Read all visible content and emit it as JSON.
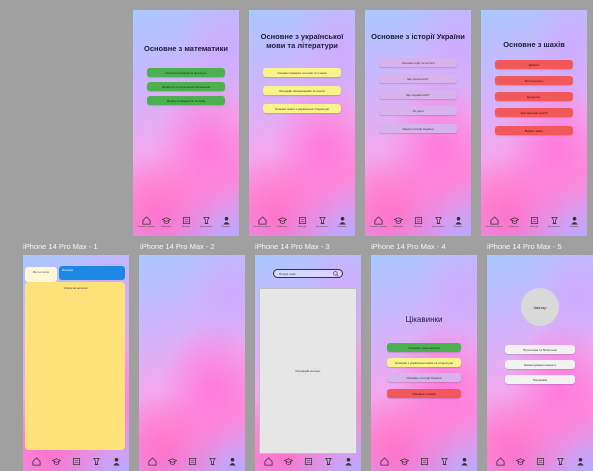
{
  "frames_top": [
    {
      "id": "f1",
      "title": "Основне з математики",
      "buttons": [
        {
          "label": "Основні алгебраїчні формули",
          "color": "green"
        },
        {
          "label": "Формули зі скороченого множення",
          "color": "green"
        },
        {
          "label": "Формули квадратів та кубів",
          "color": "green"
        }
      ]
    },
    {
      "id": "f2",
      "title": "Основне з української мови та літератури",
      "buttons": [
        {
          "label": "Основні правила та поняття з мови",
          "color": "yellow"
        },
        {
          "label": "Біографії письменників та поетів",
          "color": "yellow"
        },
        {
          "label": "Основні твори з української літератури",
          "color": "yellow"
        }
      ]
    },
    {
      "id": "f3",
      "title": "Основне з історії України",
      "buttons": [
        {
          "label": "Основні події та постаті",
          "color": "lilac"
        },
        {
          "label": "Що прочитати?",
          "color": "lilac"
        },
        {
          "label": "Що подивитися?",
          "color": "lilac"
        },
        {
          "label": "Усі дати",
          "color": "lilac"
        },
        {
          "label": "Карти з історії України",
          "color": "lilac"
        }
      ]
    },
    {
      "id": "f4",
      "title": "Основне з шахів",
      "buttons": [
        {
          "label": "Дебюти",
          "color": "red"
        },
        {
          "label": "Міттельшпіль",
          "color": "red"
        },
        {
          "label": "Ендшпіль",
          "color": "red"
        },
        {
          "label": "Чим важливі шахи?",
          "color": "red"
        },
        {
          "label": "Відомі гравці",
          "color": "red"
        }
      ]
    }
  ],
  "frame_labels": [
    "iPhone 14 Pro Max - 1",
    "iPhone 14 Pro Max - 2",
    "iPhone 14 Pro Max - 3",
    "iPhone 14 Pro Max - 4",
    "iPhone 14 Pro Max - 5"
  ],
  "nav_top": [
    {
      "icon": "home-icon",
      "caption": "Головна сторінка"
    },
    {
      "icon": "graduation-cap-icon",
      "caption": "Навчання"
    },
    {
      "icon": "notes-icon",
      "caption": "Нотатки"
    },
    {
      "icon": "trophy-icon",
      "caption": "Досягнення"
    },
    {
      "icon": "user-icon",
      "caption": "Профіль"
    }
  ],
  "notes_frame": {
    "chip": "Мої нотатки",
    "tab": "Нотатки",
    "sub": "Статичні нотатки"
  },
  "search_frame": {
    "placeholder": "Пошук теми",
    "results": "Основний контент"
  },
  "interests_frame": {
    "title": "Цікавинки",
    "buttons": [
      {
        "label": "Основне з математики",
        "color": "green"
      },
      {
        "label": "Основне з української мови та літератури",
        "color": "yellow"
      },
      {
        "label": "Основне з історії України",
        "color": "lilac"
      },
      {
        "label": "Основне з шахів",
        "color": "red"
      }
    ]
  },
  "profile_frame": {
    "avatar": "Аватар",
    "buttons": [
      {
        "label": "Прочитана та бібліотека",
        "color": "white"
      },
      {
        "label": "Налаштування акаунту",
        "color": "white"
      },
      {
        "label": "Підтримка",
        "color": "white"
      }
    ]
  }
}
